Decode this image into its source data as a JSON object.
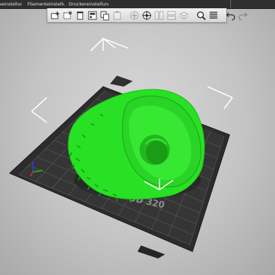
{
  "tabs": [
    {
      "label": "eeinstellungen",
      "icon": "print-settings-icon"
    },
    {
      "label": "Filamenteinstellungen",
      "icon": "filament-icon"
    },
    {
      "label": "Druckereinstellungen",
      "icon": "printer-icon"
    }
  ],
  "toolbar_icons": [
    "add-object-icon",
    "delete-icon",
    "delete-all-icon",
    "arrange-icon",
    "copy-icon",
    "paste-icon",
    "add-instance-icon",
    "remove-instance-icon",
    "split-icon",
    "split-parts-icon",
    "layers-icon",
    "zoom-icon",
    "layer-editing-icon",
    "undo-icon",
    "redo-icon"
  ],
  "bed": {
    "label": "3D 320"
  },
  "colors": {
    "model": "#22e51f",
    "bed": "#2a2a2a",
    "grid": "#5a5a5a",
    "toolbar": "#e6e6e6"
  }
}
